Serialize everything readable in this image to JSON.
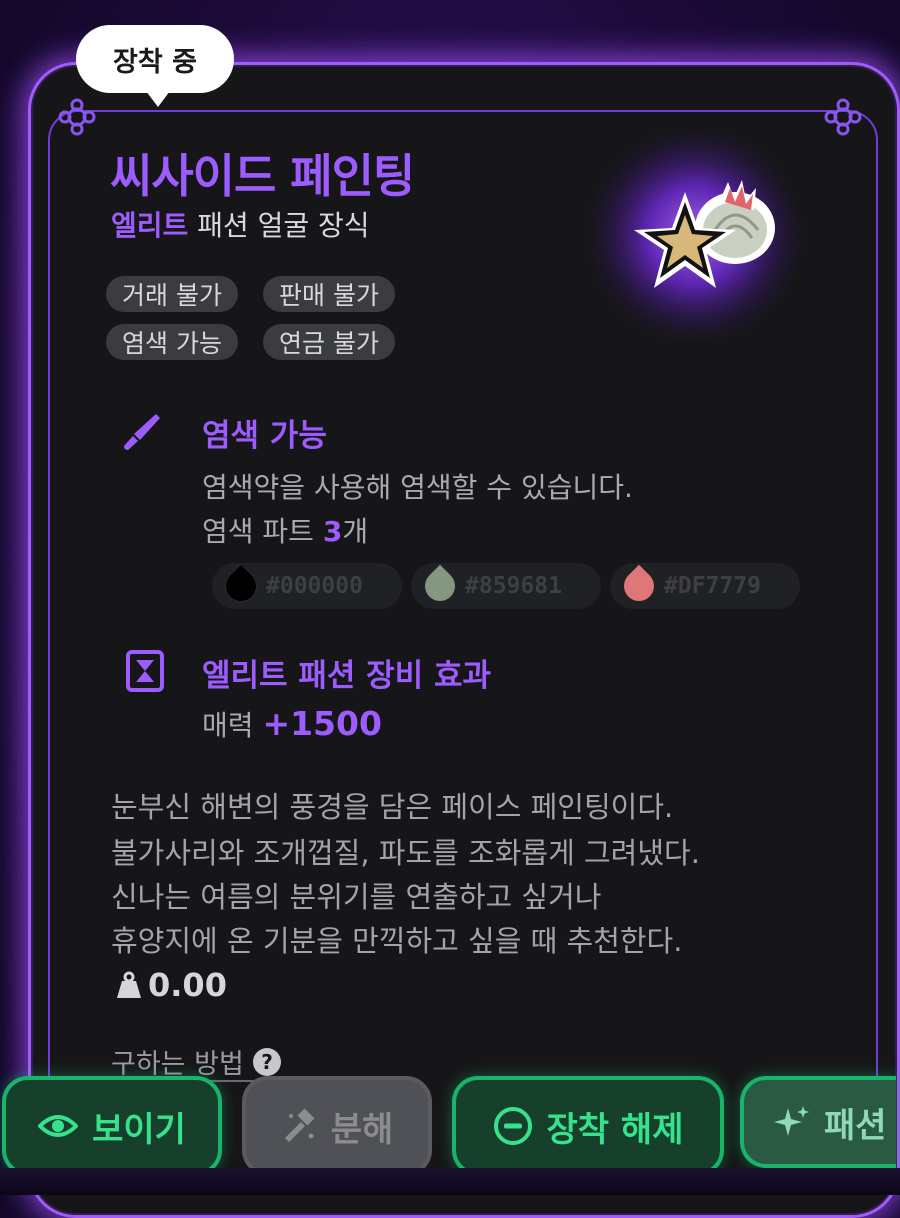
{
  "equip_badge": "장착 중",
  "item": {
    "name": "씨사이드 페인팅",
    "rarity": "엘리트",
    "category": "패션 얼굴 장식"
  },
  "tags": [
    "거래 불가",
    "판매 불가",
    "염색 가능",
    "연금 불가"
  ],
  "dye": {
    "title": "염색 가능",
    "description": "염색약을 사용해 염색할 수 있습니다.",
    "parts_label": "염색 파트",
    "parts_count": "3",
    "parts_unit": "개",
    "colors": [
      {
        "hex": "#000000",
        "label": "#000000"
      },
      {
        "hex": "#859681",
        "label": "#859681"
      },
      {
        "hex": "#DF7779",
        "label": "#DF7779"
      }
    ]
  },
  "effect": {
    "title": "엘리트 패션 장비 효과",
    "stat_label": "매력",
    "stat_value": "+1500"
  },
  "description_lines": [
    "눈부신 해변의 풍경을 담은 페이스 페인팅이다.",
    "불가사리와 조개껍질, 파도를 조화롭게 그려냈다.",
    "신나는 여름의 분위기를 연출하고 싶거나",
    "휴양지에 온 기분을 만끽하고 싶을 때 추천한다."
  ],
  "weight": "0.00",
  "how_to_obtain": "구하는 방법",
  "buttons": {
    "show": "보이기",
    "disassemble": "분해",
    "unequip": "장착 해제",
    "fashion": "패션"
  },
  "icons": {
    "dye": "brush-icon",
    "effect": "hourglass-card-icon",
    "weight": "weight-icon",
    "help": "help-icon",
    "show": "eye-icon",
    "disassemble": "hammer-icon",
    "unequip": "minus-circle-icon",
    "fashion": "sparkle-icon"
  },
  "colors": {
    "accent": "#9D5CFF",
    "green": "#36E28C",
    "card_bg": "#161618"
  }
}
